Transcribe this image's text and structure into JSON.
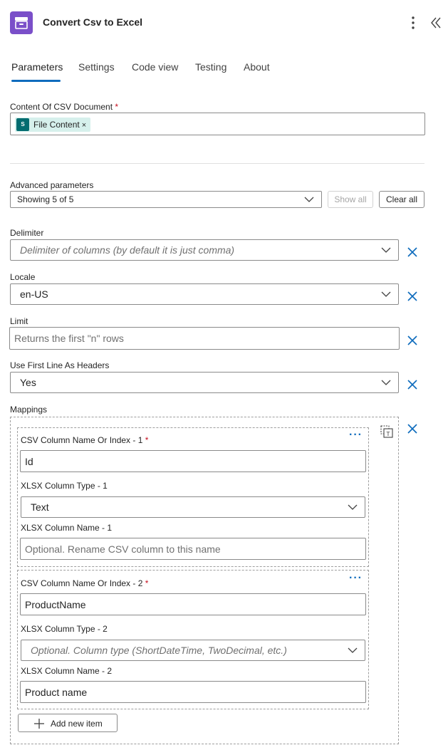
{
  "header": {
    "title": "Convert Csv to Excel",
    "app_icon": "archive-box-icon",
    "accent": "#7a4fc9"
  },
  "tabs": [
    {
      "label": "Parameters",
      "active": true
    },
    {
      "label": "Settings"
    },
    {
      "label": "Code view"
    },
    {
      "label": "Testing"
    },
    {
      "label": "About"
    }
  ],
  "content_csv": {
    "label": "Content Of CSV Document",
    "required_mark": "*",
    "token": {
      "label": "File Content",
      "icon_text": "S",
      "remove": "×"
    }
  },
  "advanced": {
    "label": "Advanced parameters",
    "value": "Showing 5 of 5",
    "show_all": "Show all",
    "clear_all": "Clear all"
  },
  "delimiter": {
    "label": "Delimiter",
    "placeholder": "Delimiter of columns (by default it is just comma)"
  },
  "locale": {
    "label": "Locale",
    "value": "en-US"
  },
  "limit": {
    "label": "Limit",
    "placeholder": "Returns the first \"n\" rows"
  },
  "headers": {
    "label": "Use First Line As Headers",
    "value": "Yes"
  },
  "mappings": {
    "label": "Mappings",
    "items": [
      {
        "name_label": "CSV Column Name Or Index - 1",
        "required_mark": "*",
        "name_value": "Id",
        "type_label": "XLSX Column Type - 1",
        "type_value": "Text",
        "rename_label": "XLSX Column Name - 1",
        "rename_placeholder": "Optional. Rename CSV column to this name"
      },
      {
        "name_label": "CSV Column Name Or Index - 2",
        "required_mark": "*",
        "name_value": "ProductName",
        "type_label": "XLSX Column Type - 2",
        "type_placeholder": "Optional. Column type (ShortDateTime, TwoDecimal, etc.)",
        "rename_label": "XLSX Column Name - 2",
        "rename_value": "Product name"
      }
    ],
    "add_item": "Add new item"
  }
}
